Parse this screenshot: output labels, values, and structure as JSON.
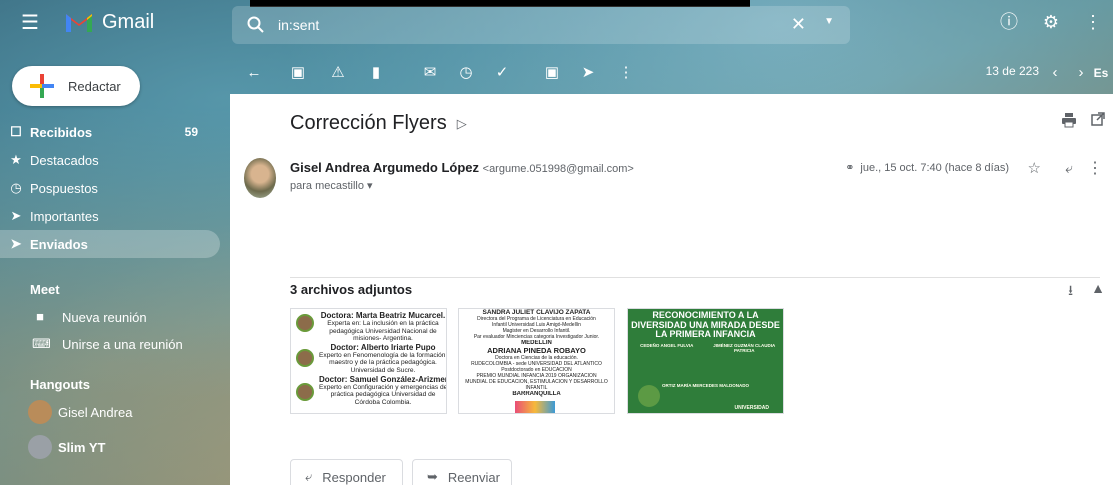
{
  "app": {
    "title": "Gmail",
    "brand_colors": {
      "red": "#ea4335",
      "blue": "#4285f4",
      "green": "#34a853",
      "yellow": "#fbbc04"
    }
  },
  "search": {
    "value": "in:sent",
    "clear_icon": "close-icon",
    "options_icon": "chevron-down-icon"
  },
  "header_icons": [
    "help-icon",
    "settings-icon",
    "apps-icon"
  ],
  "compose": {
    "label": "Redactar"
  },
  "nav": {
    "items": [
      {
        "label": "Recibidos",
        "count": "59",
        "icon": "inbox-icon"
      },
      {
        "label": "Destacados",
        "icon": "star-icon"
      },
      {
        "label": "Pospuestos",
        "icon": "clock-icon"
      },
      {
        "label": "Importantes",
        "icon": "important-icon"
      },
      {
        "label": "Enviados",
        "icon": "send-icon"
      }
    ]
  },
  "meet": {
    "title": "Meet",
    "items": [
      {
        "label": "Nueva reunión"
      },
      {
        "label": "Unirse a una reunión"
      }
    ]
  },
  "hangouts": {
    "title": "Hangouts",
    "users": [
      {
        "name": "Gisel Andrea"
      },
      {
        "name": "Slim YT"
      }
    ]
  },
  "toolbar": {
    "pager": "13 de 223",
    "lang": "Es"
  },
  "email": {
    "subject": "Corrección Flyers",
    "sender_name": "Gisel Andrea Argumedo López",
    "sender_email": "<argume.051998@gmail.com>",
    "to": "para mecastillo",
    "date": "jue., 15 oct. 7:40 (hace 8 días)",
    "attachments_title": "3 archivos adjuntos"
  },
  "attachments": {
    "a1": {
      "lines": [
        "Doctora: Marta Beatriz Mucarcel.",
        "Experta en: La inclusión en la práctica",
        "pedagógica Universidad Nacional de",
        "misiones- Argentina.",
        "Doctor: Alberto Iriarte Pupo",
        "Experto en Fenomenología de la formación de",
        "maestro y de la práctica pedagógica.",
        "Universidad de Sucre.",
        "Doctor: Samuel González-Arizmendi",
        "Experto en Configuración y emergencias de la",
        "práctica pedagógica Universidad de",
        "Córdoba Colombia."
      ]
    },
    "a2": {
      "lines": [
        "SANDRA JULIET CLAVIJO ZAPATA",
        "Directora del Programa de Licenciatura en Educación",
        "Infantil Universidad Luis Amigó-Medellín",
        "Magister en Desarrollo Infantil.",
        "Par evaluador Minciencias categoria Investigador Junior.",
        "MEDELLÍN",
        "ADRIANA PINEDA ROBAYO",
        "Doctora en Ciencias de la educación.",
        "RUDECOLOMBIA - sede UNIVERSIDAD DEL ATLANTICO",
        "Postdoctorado en EDUCACIÓN",
        "PREMIO MUNDIAL INFANCIA 2019 ORGANIZACIÓN",
        "MUNDIAL DE EDUCACIÓN, ESTIMULACIÓN Y DESARROLLO",
        "INFANTIL",
        "BARRANQUILLA"
      ]
    },
    "a3": {
      "title": "RECONOCIMIENTO A LA DIVERSIDAD UNA MIRADA DESDE LA PRIMERA INFANCIA",
      "left_name": "CEDEÑO ANGEL FULVIA",
      "right_name": "JIMÉNEZ GUZMÁN CLAUDIA PATRICIA",
      "bottom_name": "ORTIZ MARÍA MERCEDES MALDONADO",
      "footer": "UNIVERSIDAD"
    }
  },
  "buttons": {
    "reply": "Responder",
    "forward": "Reenviar"
  }
}
